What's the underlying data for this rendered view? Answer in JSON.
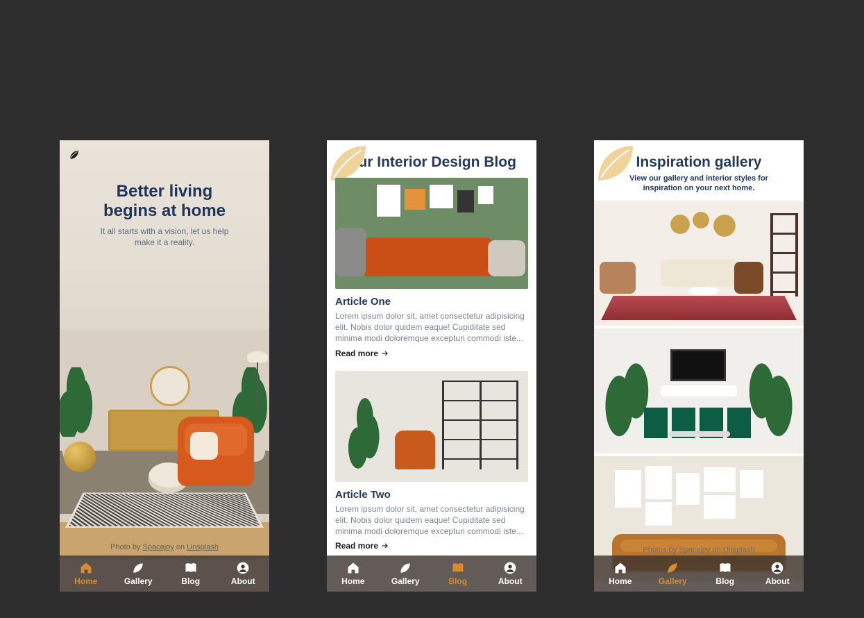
{
  "nav": {
    "items": [
      {
        "key": "home",
        "label": "Home",
        "icon": "home-icon"
      },
      {
        "key": "gallery",
        "label": "Gallery",
        "icon": "leaf-icon"
      },
      {
        "key": "blog",
        "label": "Blog",
        "icon": "book-icon"
      },
      {
        "key": "about",
        "label": "About",
        "icon": "user-icon"
      }
    ]
  },
  "home": {
    "title_line1": "Better living",
    "title_line2": "begins at home",
    "subtitle": "It all starts with a vision, let us help make it a reality.",
    "credit_prefix": "Photo by ",
    "credit_author": "Spacejoy",
    "credit_middle": " on ",
    "credit_site": "Unsplash",
    "active_nav": "home"
  },
  "blog": {
    "title": "Our Interior Design Blog",
    "articles": [
      {
        "title": "Article One",
        "excerpt": "Lorem ipsum dolor sit, amet consectetur adipisicing elit. Nobis dolor quidem eaque! Cupiditate sed minima modi doloremque excepturi commodi iste...",
        "read_more": "Read more"
      },
      {
        "title": "Article Two",
        "excerpt": "Lorem ipsum dolor sit, amet consectetur adipisicing elit. Nobis dolor quidem eaque! Cupiditate sed minima modi doloremque excepturi commodi iste...",
        "read_more": "Read more"
      }
    ],
    "active_nav": "blog"
  },
  "gallery": {
    "title": "Inspiration gallery",
    "subtitle": "View our gallery and interior styles for inspiration on your next home.",
    "credit_prefix": "Photos by ",
    "credit_author": "Spacejoy",
    "credit_middle": " on ",
    "credit_site": "Unsplash",
    "active_nav": "gallery"
  },
  "colors": {
    "accent": "#d78b2d",
    "heading": "#22385d",
    "navbg": "rgba(60,50,45,0.80)"
  }
}
